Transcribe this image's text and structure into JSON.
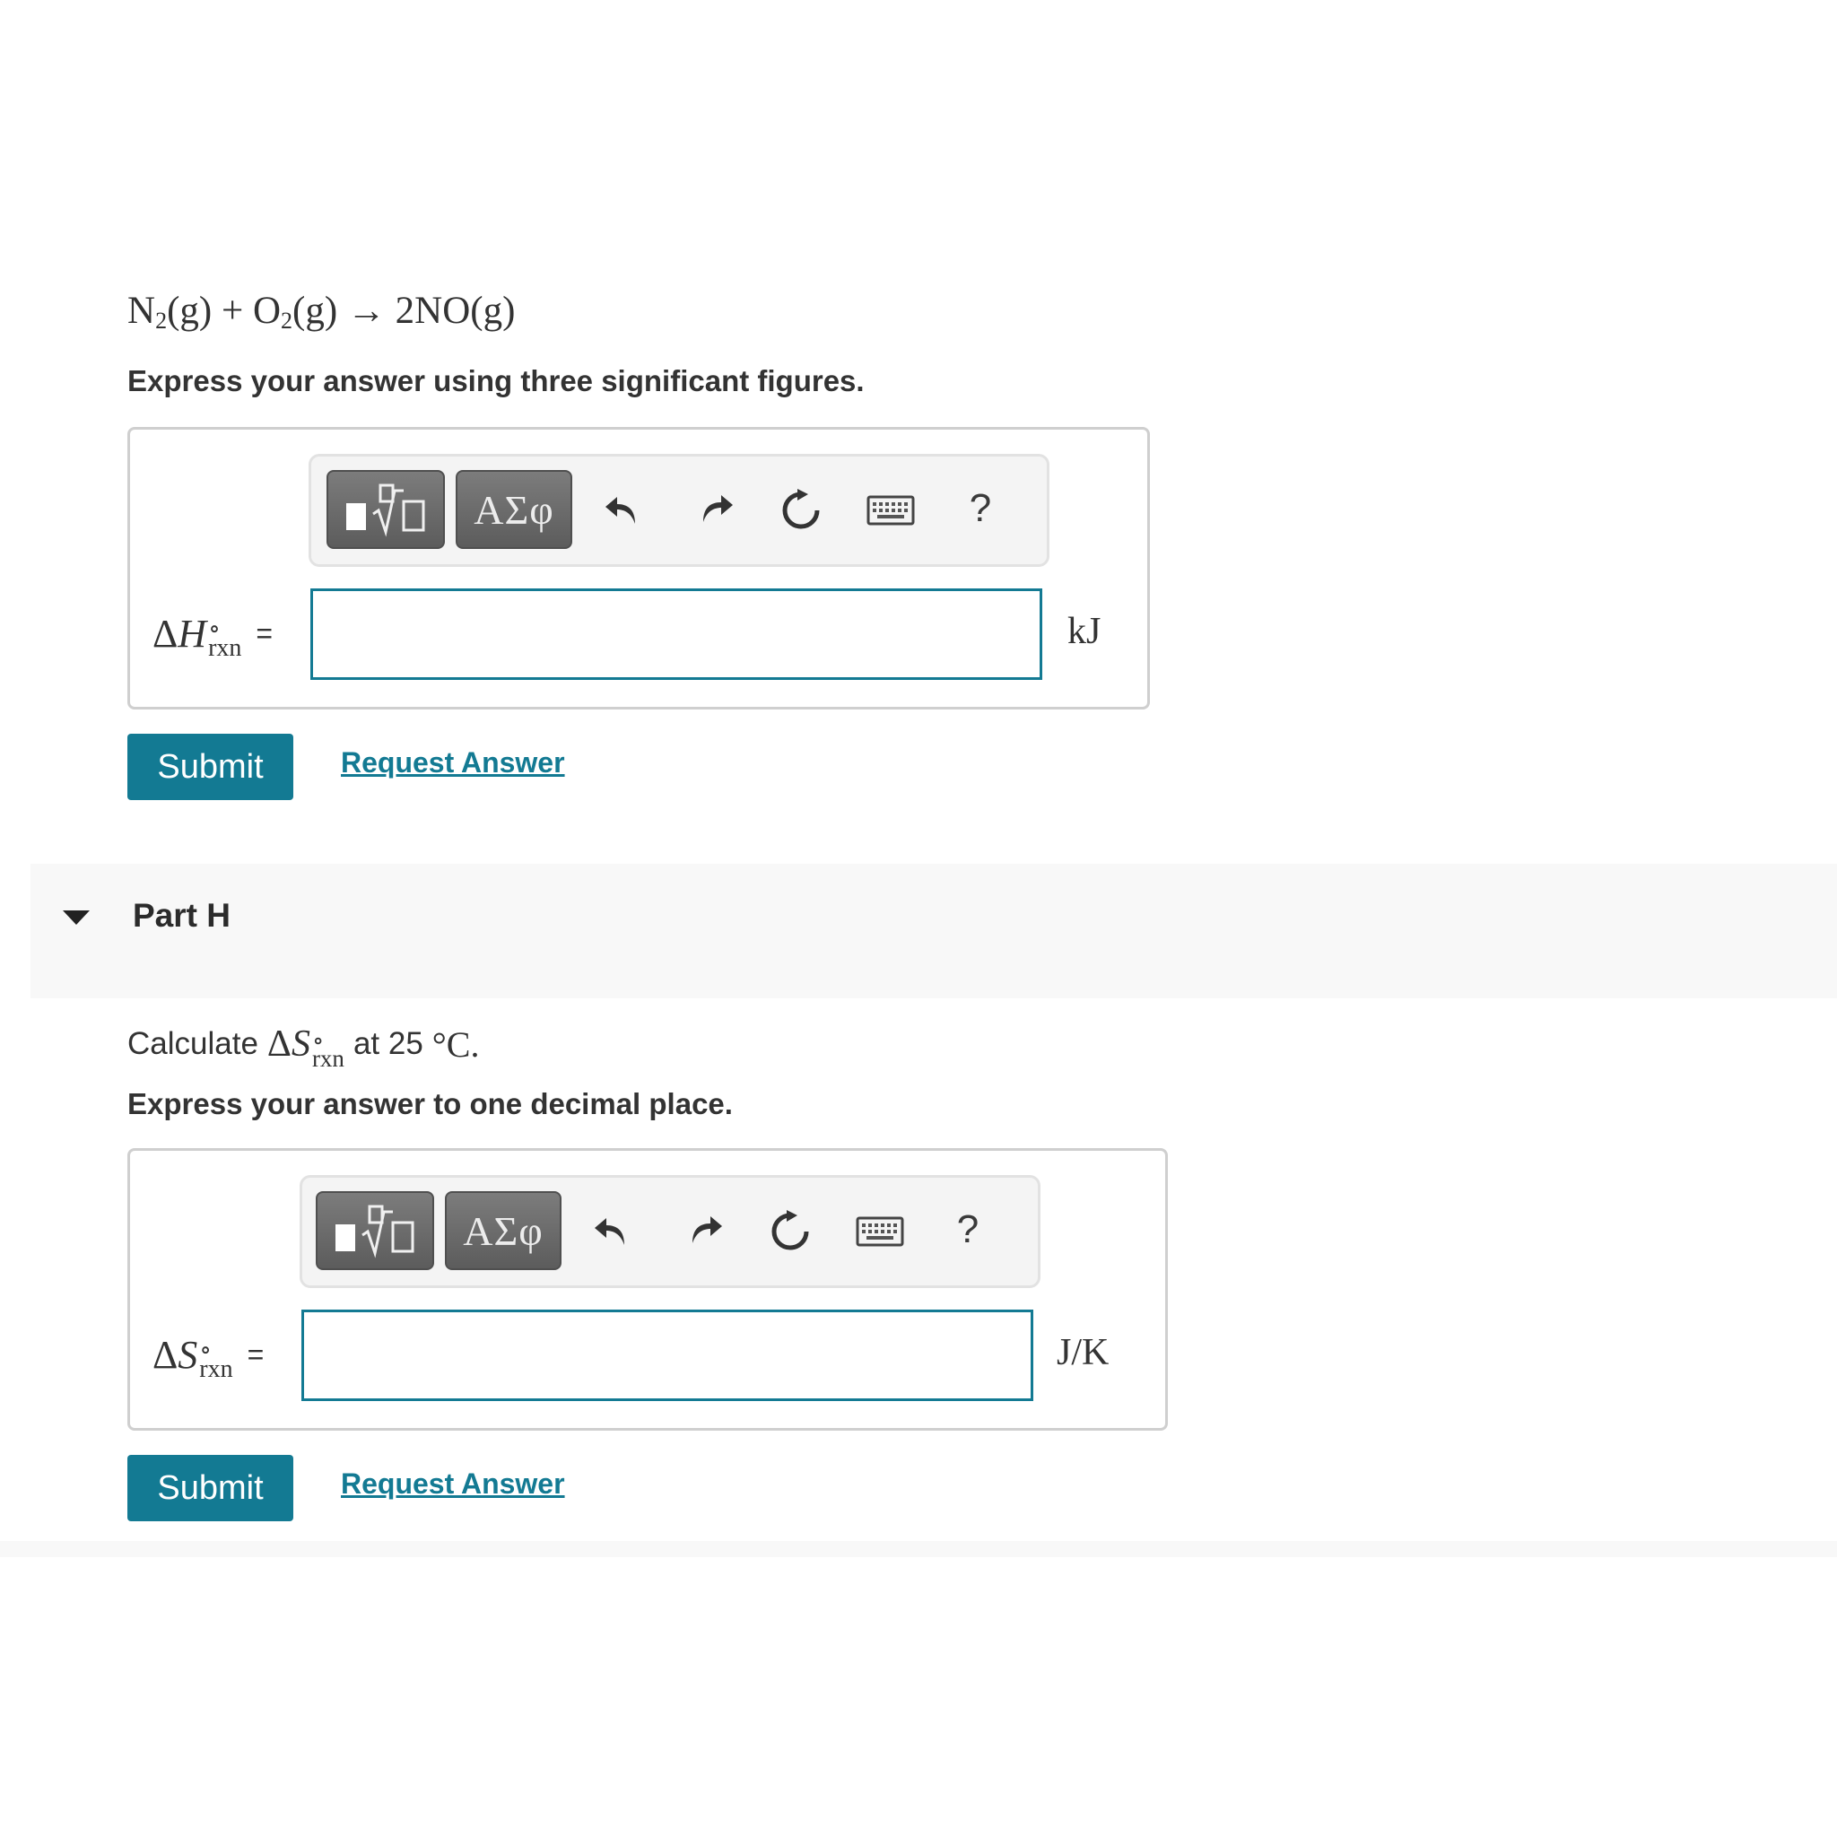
{
  "part_g": {
    "equation": {
      "reactant1": "N",
      "reactant1_sub": "2",
      "reactant1_state": "(g)",
      "plus": "+",
      "reactant2": "O",
      "reactant2_sub": "2",
      "reactant2_state": "(g)",
      "arrow": "→",
      "product": "2NO(g)"
    },
    "instruction": "Express your answer using three significant figures.",
    "toolbar": {
      "templates_glyph": "√",
      "greek_label": "ΑΣφ",
      "help_label": "?"
    },
    "variable": {
      "delta": "Δ",
      "symbol": "H",
      "superscript": "∘",
      "subscript": "rxn",
      "equals": "="
    },
    "input_value": "",
    "unit": "kJ",
    "submit_label": "Submit",
    "request_answer_label": "Request Answer"
  },
  "part_h": {
    "title": "Part H",
    "calc": {
      "prefix": "Calculate",
      "delta": "Δ",
      "symbol": "S",
      "superscript": "∘",
      "subscript": "rxn",
      "mid": "at 25",
      "unit": "°C",
      "suffix": "."
    },
    "instruction": "Express your answer to one decimal place.",
    "toolbar": {
      "templates_glyph": "√",
      "greek_label": "ΑΣφ",
      "help_label": "?"
    },
    "variable": {
      "delta": "Δ",
      "symbol": "S",
      "superscript": "∘",
      "subscript": "rxn",
      "equals": "="
    },
    "input_value": "",
    "unit": "J/K",
    "submit_label": "Submit",
    "request_answer_label": "Request Answer"
  },
  "colors": {
    "accent": "#137a93",
    "toolbar_button": "#6a6a6a",
    "part_header_bg": "#f8f8f8"
  },
  "icons": [
    "templates-icon",
    "undo-icon",
    "redo-icon",
    "reset-icon",
    "keyboard-icon",
    "help-icon",
    "collapse-caret-icon"
  ]
}
